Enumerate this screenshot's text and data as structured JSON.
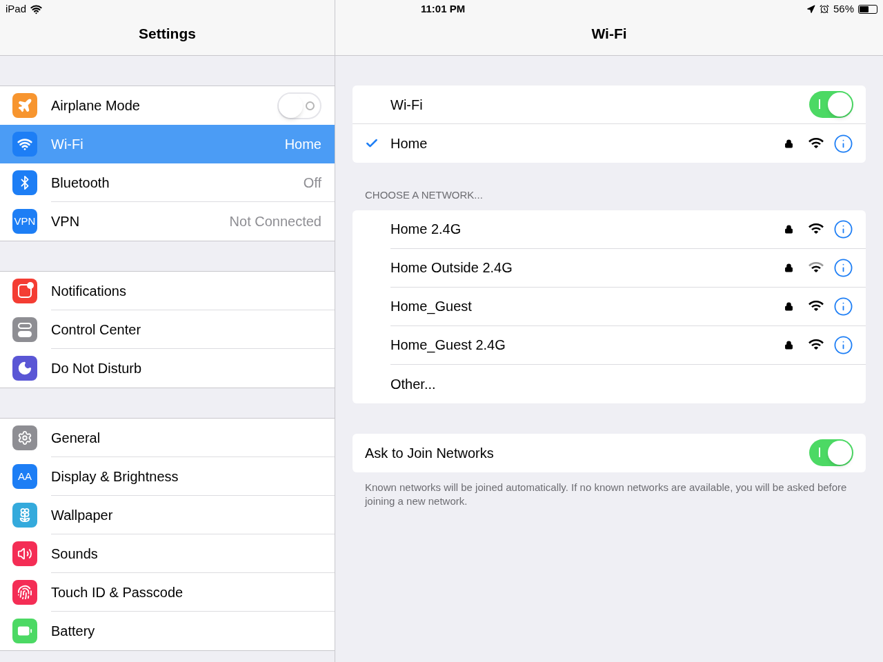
{
  "status_bar": {
    "device": "iPad",
    "time": "11:01 PM",
    "battery": "56%"
  },
  "sidebar": {
    "title": "Settings",
    "groups": [
      [
        {
          "label": "Airplane Mode",
          "kind": "airplane",
          "color": "#f7952f",
          "on": false,
          "selected": false
        },
        {
          "label": "Wi-Fi",
          "kind": "wifi",
          "color": "#1d7ef5",
          "value": "Home",
          "selected": true
        },
        {
          "label": "Bluetooth",
          "kind": "bluetooth",
          "color": "#1d7ef5",
          "value": "Off",
          "selected": false
        },
        {
          "label": "VPN",
          "kind": "text",
          "icon_text": "VPN",
          "color": "#1d7ef5",
          "value": "Not Connected",
          "selected": false
        }
      ],
      [
        {
          "label": "Notifications",
          "kind": "notifications",
          "color": "#f43d33",
          "selected": false
        },
        {
          "label": "Control Center",
          "kind": "control",
          "color": "#8e8e93",
          "selected": false
        },
        {
          "label": "Do Not Disturb",
          "kind": "moon",
          "color": "#5a56d5",
          "selected": false
        }
      ],
      [
        {
          "label": "General",
          "kind": "gear",
          "color": "#8e8e93",
          "selected": false
        },
        {
          "label": "Display & Brightness",
          "kind": "text",
          "icon_text": "AA",
          "color": "#1d7ef5",
          "selected": false
        },
        {
          "label": "Wallpaper",
          "kind": "flower",
          "color": "#34aadc",
          "selected": false
        },
        {
          "label": "Sounds",
          "kind": "sound",
          "color": "#f42d55",
          "selected": false
        },
        {
          "label": "Touch ID & Passcode",
          "kind": "fingerprint",
          "color": "#f42d55",
          "selected": false
        },
        {
          "label": "Battery",
          "kind": "battery",
          "color": "#4cd964",
          "selected": false
        }
      ]
    ]
  },
  "detail": {
    "title": "Wi-Fi",
    "wifi": {
      "label": "Wi-Fi",
      "on": true
    },
    "current": {
      "name": "Home",
      "checked": true,
      "locked": true,
      "strong": true
    },
    "section_header": "CHOOSE A NETWORK...",
    "networks": [
      {
        "name": "Home 2.4G",
        "locked": true,
        "strong": true
      },
      {
        "name": "Home Outside 2.4G",
        "locked": true,
        "strong": false
      },
      {
        "name": "Home_Guest",
        "locked": true,
        "strong": true
      },
      {
        "name": "Home_Guest 2.4G",
        "locked": true,
        "strong": true
      }
    ],
    "other": "Other...",
    "ask": {
      "label": "Ask to Join Networks",
      "on": true
    },
    "footer": "Known networks will be joined automatically. If no known networks are available, you will be asked before joining a new network."
  }
}
